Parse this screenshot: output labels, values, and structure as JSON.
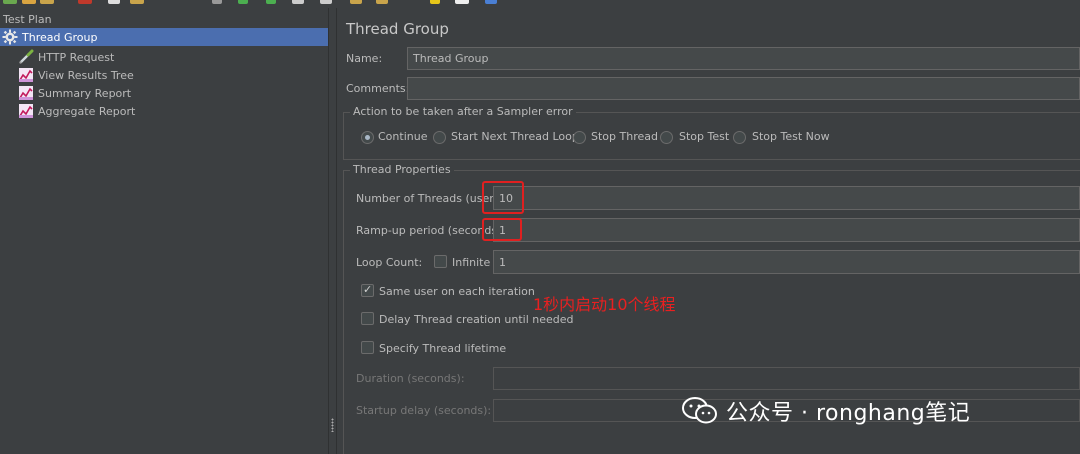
{
  "tree": {
    "root_label": "Test Plan",
    "items": [
      {
        "label": "Thread Group",
        "icon": "gear-icon",
        "selected": true
      },
      {
        "label": "HTTP Request",
        "icon": "pipette-icon",
        "selected": false
      },
      {
        "label": "View Results Tree",
        "icon": "graph-icon",
        "selected": false
      },
      {
        "label": "Summary Report",
        "icon": "graph-icon",
        "selected": false
      },
      {
        "label": "Aggregate Report",
        "icon": "graph-icon",
        "selected": false
      }
    ]
  },
  "panel": {
    "title": "Thread Group",
    "name_label": "Name:",
    "name_value": "Thread Group",
    "comments_label": "Comments:",
    "comments_value": "",
    "sampler_error": {
      "legend": "Action to be taken after a Sampler error",
      "options": [
        "Continue",
        "Start Next Thread Loop",
        "Stop Thread",
        "Stop Test",
        "Stop Test Now"
      ],
      "selected": "Continue"
    },
    "thread_props": {
      "legend": "Thread Properties",
      "num_threads_label": "Number of Threads (users):",
      "num_threads_value": "10",
      "rampup_label": "Ramp-up period (seconds):",
      "rampup_value": "1",
      "loop_label": "Loop Count:",
      "infinite_label": "Infinite",
      "infinite_checked": false,
      "loop_value": "1",
      "same_user_label": "Same user on each iteration",
      "same_user_checked": true,
      "delay_label": "Delay Thread creation until needed",
      "delay_checked": false,
      "lifetime_label": "Specify Thread lifetime",
      "lifetime_checked": false,
      "duration_label": "Duration (seconds):",
      "duration_value": "",
      "startup_label": "Startup delay (seconds):",
      "startup_value": ""
    }
  },
  "annotation": "1秒内启动10个线程",
  "watermark": "公众号 · ronghang笔记",
  "colors": {
    "background": "#3c3f41",
    "selection": "#4b6eaf",
    "annotation_red": "#e02020",
    "field_bg": "#45494a"
  }
}
